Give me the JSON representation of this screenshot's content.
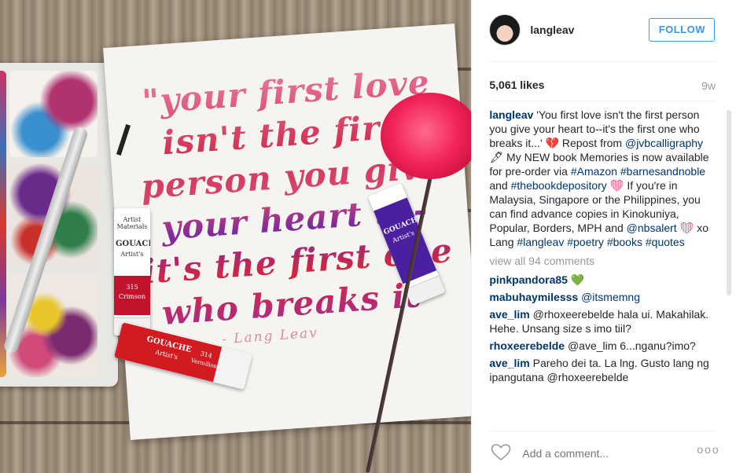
{
  "photo": {
    "quote_lines": [
      "\"your first love",
      "isn't the first",
      "person you give",
      "your heart to-",
      "it's the first one",
      "who breaks it\""
    ],
    "signature": "- Lang Leav",
    "tubes": [
      {
        "brand": "Artist Materials",
        "name": "GOUACHE",
        "sub": "Artist's",
        "num": "315",
        "color_name": "Crimson"
      },
      {
        "brand": "",
        "name": "GOUACHE",
        "sub": "Artist's",
        "num": "314",
        "color_name": "Vermilion"
      },
      {
        "brand": "",
        "name": "GOUACHE",
        "sub": "Artist's",
        "num": "",
        "color_name": ""
      }
    ]
  },
  "header": {
    "username": "langleav",
    "follow_label": "FOLLOW"
  },
  "meta": {
    "likes": "5,061 likes",
    "age": "9w"
  },
  "caption": {
    "user": "langleav",
    "t1": " 'You first love isn't the first person you give your heart to--it's the first one who breaks it...' ",
    "e1": "💔",
    "t2": " Repost from ",
    "tag1": "@jvbcalligraphy",
    "e2": "🖋",
    "t3": " My NEW book Memories is now available for pre-order via ",
    "tag2": "#Amazon",
    "tag3": "#barnesandnoble",
    "t4": " and ",
    "tag4": "#thebookdepository",
    "e3": "❤",
    "t5": " If you're in Malaysia, Singapore or the Philippines, you can find advance copies in Kinokuniya, Popular, Borders, MPH and ",
    "tag5": "@nbsalert",
    "e4": "❤",
    "t6": " xo Lang ",
    "tag6": "#langleav",
    "tag7": "#poetry",
    "tag8": "#books",
    "tag9": "#quotes"
  },
  "view_all": "view all 94 comments",
  "comments": [
    {
      "user": "pinkpandora85",
      "text": " 💚"
    },
    {
      "user": "mabuhaymilesss",
      "text": " @itsmemng"
    },
    {
      "user": "ave_lim",
      "text": " @rhoxeerebelde hala ui. Makahilak. Hehe. Unsang size s imo tiil?"
    },
    {
      "user": "rhoxeerebelde",
      "text": " @ave_lim 6...nganu?imo?"
    },
    {
      "user": "ave_lim",
      "text": " Pareho dei ta. La lng. Gusto lang ng ipangutana @rhoxeerebelde"
    }
  ],
  "footer": {
    "placeholder": "Add a comment...",
    "more": "ooo"
  },
  "colors": {
    "link": "#003569",
    "follow_blue": "#3897f0",
    "muted": "#999999"
  }
}
